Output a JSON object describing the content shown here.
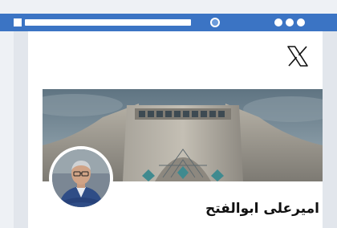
{
  "profile": {
    "display_name": "امیرعلی ابوالفتح"
  },
  "icons": {
    "window_square": "square-icon",
    "address_bar": "address-bar",
    "window_control": "circle-icon",
    "menu": "more-dots-icon",
    "brand": "x-logo-icon"
  },
  "colors": {
    "chrome": "#3b74c4",
    "card": "#ffffff",
    "page": "#eef1f5"
  }
}
